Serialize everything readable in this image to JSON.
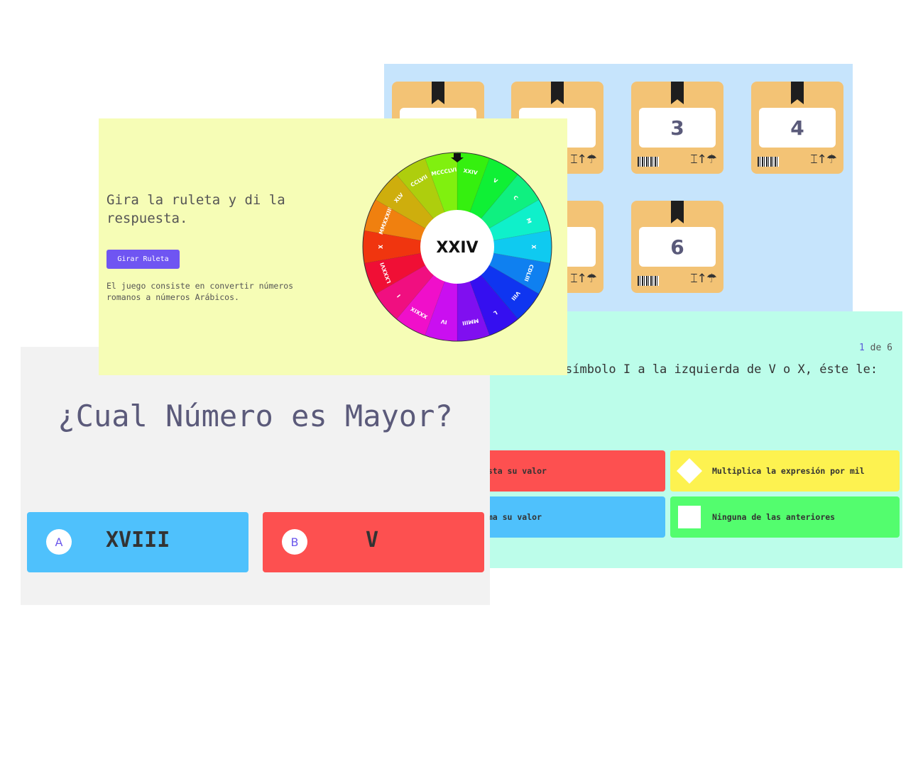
{
  "boxes_panel": {
    "boxes": [
      {
        "number": ""
      },
      {
        "number": ""
      },
      {
        "number": "3"
      },
      {
        "number": "4"
      },
      {
        "number": ""
      },
      {
        "number": "6"
      }
    ],
    "handling_symbols": "⌶↑☂"
  },
  "roulette_panel": {
    "title": "Gira la ruleta y di la respuesta.",
    "button_label": "Girar Ruleta",
    "description": "El juego consiste en convertir números romanos a números Arábicos.",
    "center_value": "XXIV",
    "segments": [
      "XXIV",
      "V",
      "C",
      "M",
      "X",
      "CDLIII",
      "VIII",
      "L",
      "MMIII",
      "IV",
      "XXXIX",
      "I",
      "LXXXVI",
      "X",
      "MMXXXIII",
      "XLV",
      "CCLVII",
      "MCCCLVI"
    ]
  },
  "question_panel": {
    "title": "¿Cual Número es Mayor?",
    "options": [
      {
        "letter": "A",
        "value": "XVIII",
        "color": "#4fc1fc"
      },
      {
        "letter": "B",
        "value": "V",
        "color": "#fd5050"
      }
    ]
  },
  "quiz_panel": {
    "counter_current": "1",
    "counter_rest": " de 6",
    "question": "símbolo I a la izquierda de V o X, éste le:",
    "options": [
      {
        "text": "Resta su valor",
        "shape": "triangle-icon",
        "color": "#fd5050"
      },
      {
        "text": "Multiplica la expresión por mil",
        "shape": "diamond-icon",
        "color": "#fdf250"
      },
      {
        "text": "Suma su valor",
        "shape": "circle-icon",
        "color": "#4fc1fc"
      },
      {
        "text": "Ninguna de las anteriores",
        "shape": "square-icon",
        "color": "#53fd6e"
      }
    ]
  }
}
